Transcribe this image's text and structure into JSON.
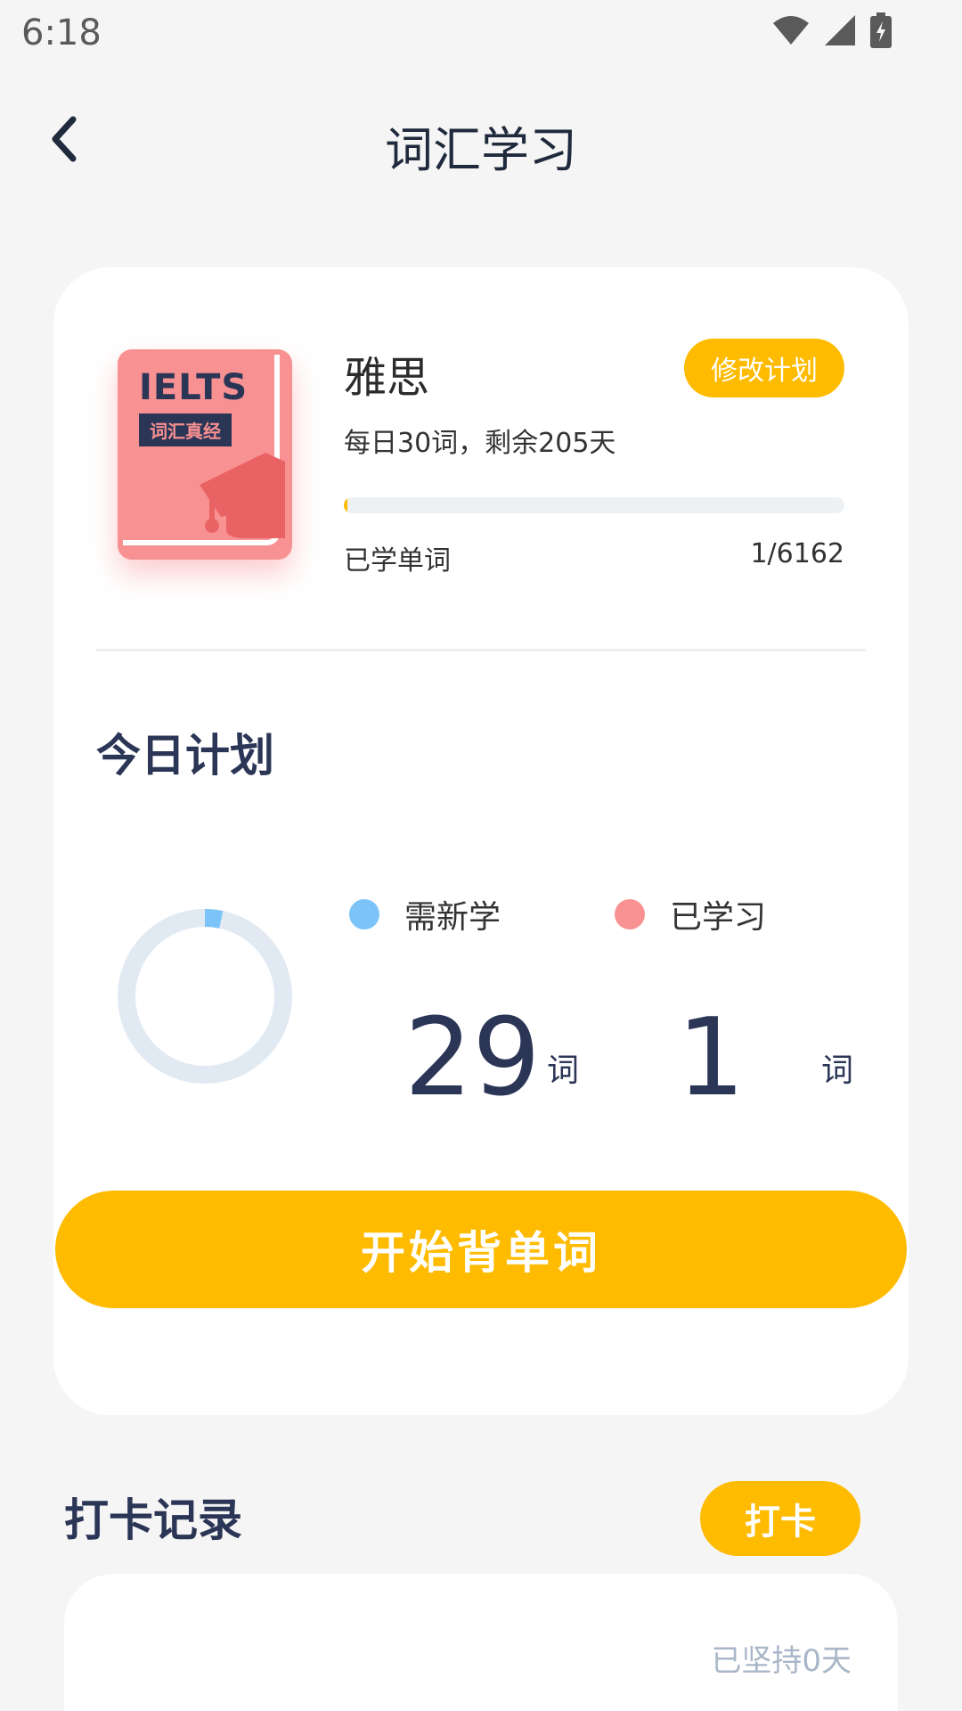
{
  "status_bar": {
    "time": "6:18",
    "icons": [
      "wifi-icon",
      "signal-icon",
      "battery-charging-icon"
    ]
  },
  "header": {
    "title": "词汇学习",
    "back_icon": "chevron-left-icon"
  },
  "book": {
    "cover_title": "IELTS",
    "cover_subtitle": "词汇真经",
    "name": "雅思",
    "edit_plan_label": "修改计划",
    "plan_desc": "每日30词，剩余205天",
    "learned_label": "已学单词",
    "learned_count": "1/6162",
    "progress_fraction": 0.000162
  },
  "today_plan": {
    "title": "今日计划",
    "legend_new": "需新学",
    "legend_done": "已学习",
    "new_count": "29",
    "done_count": "1",
    "unit": "词",
    "start_label": "开始背单词",
    "done_fraction": 0.0333
  },
  "checkin": {
    "title": "打卡记录",
    "button_label": "打卡",
    "streak_text": "已坚持0天"
  },
  "colors": {
    "accent": "#ffbb00",
    "new_dot": "#7cc4f8",
    "done_dot": "#f89192",
    "title_text": "#2b3556",
    "background": "#f5f5f5"
  }
}
